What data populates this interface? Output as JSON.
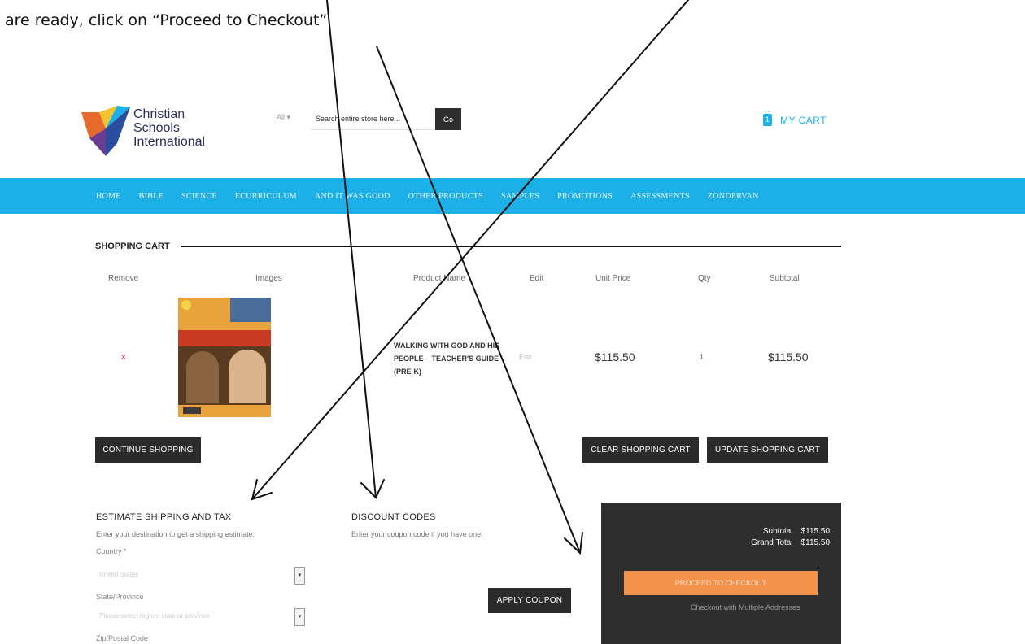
{
  "instruction": "are ready, click on “Proceed to Checkout”",
  "logo": {
    "line1": "Christian",
    "line2": "Schools",
    "line3": "International"
  },
  "search": {
    "scope": "All ▾",
    "placeholder": "Search entire store here...",
    "button": "Go"
  },
  "header": {
    "cart_label": "MY CART",
    "cart_icon": "cart-bag-icon",
    "cart_count": "1"
  },
  "nav": [
    "HOME",
    "BIBLE",
    "SCIENCE",
    "ECURRICULUM",
    "AND IT WAS GOOD",
    "OTHER PRODUCTS",
    "SAMPLES",
    "PROMOTIONS",
    "ASSESSMENTS",
    "ZONDERVAN"
  ],
  "cart": {
    "title": "SHOPPING CART",
    "columns": [
      "Remove",
      "Images",
      "Product Name",
      "Edit",
      "Unit Price",
      "Qty",
      "Subtotal"
    ],
    "item": {
      "remove": "x",
      "name": "WALKING WITH GOD AND HIS PEOPLE – TEACHER'S GUIDE (PRE-K)",
      "edit": "Edit",
      "unit_price": "$115.50",
      "qty": "1",
      "subtotal": "$115.50"
    },
    "continue_btn": "CONTINUE SHOPPING",
    "clear_btn": "CLEAR SHOPPING CART",
    "update_btn": "UPDATE SHOPPING CART"
  },
  "shipping": {
    "title": "ESTIMATE SHIPPING AND TAX",
    "subtitle": "Enter your destination to get a shipping estimate.",
    "country_label": "Country *",
    "country_value": "United States",
    "state_label": "State/Province",
    "state_value": "Please select region, state or province",
    "zip_label": "Zip/Postal Code"
  },
  "discount": {
    "title": "DISCOUNT CODES",
    "subtitle": "Enter your coupon code if you have one.",
    "apply_btn": "APPLY COUPON"
  },
  "totals": {
    "subtotal_label": "Subtotal",
    "subtotal_value": "$115.50",
    "grand_label": "Grand Total",
    "grand_value": "$115.50",
    "proceed_btn": "PROCEED TO CHECKOUT",
    "multi_link": "Checkout with Multiple Addresses"
  },
  "colors": {
    "nav_bg": "#1cb0e6",
    "proceed_bg": "#f5924a",
    "dark_btn": "#2b2b2b",
    "remove_x": "#e0274a"
  }
}
